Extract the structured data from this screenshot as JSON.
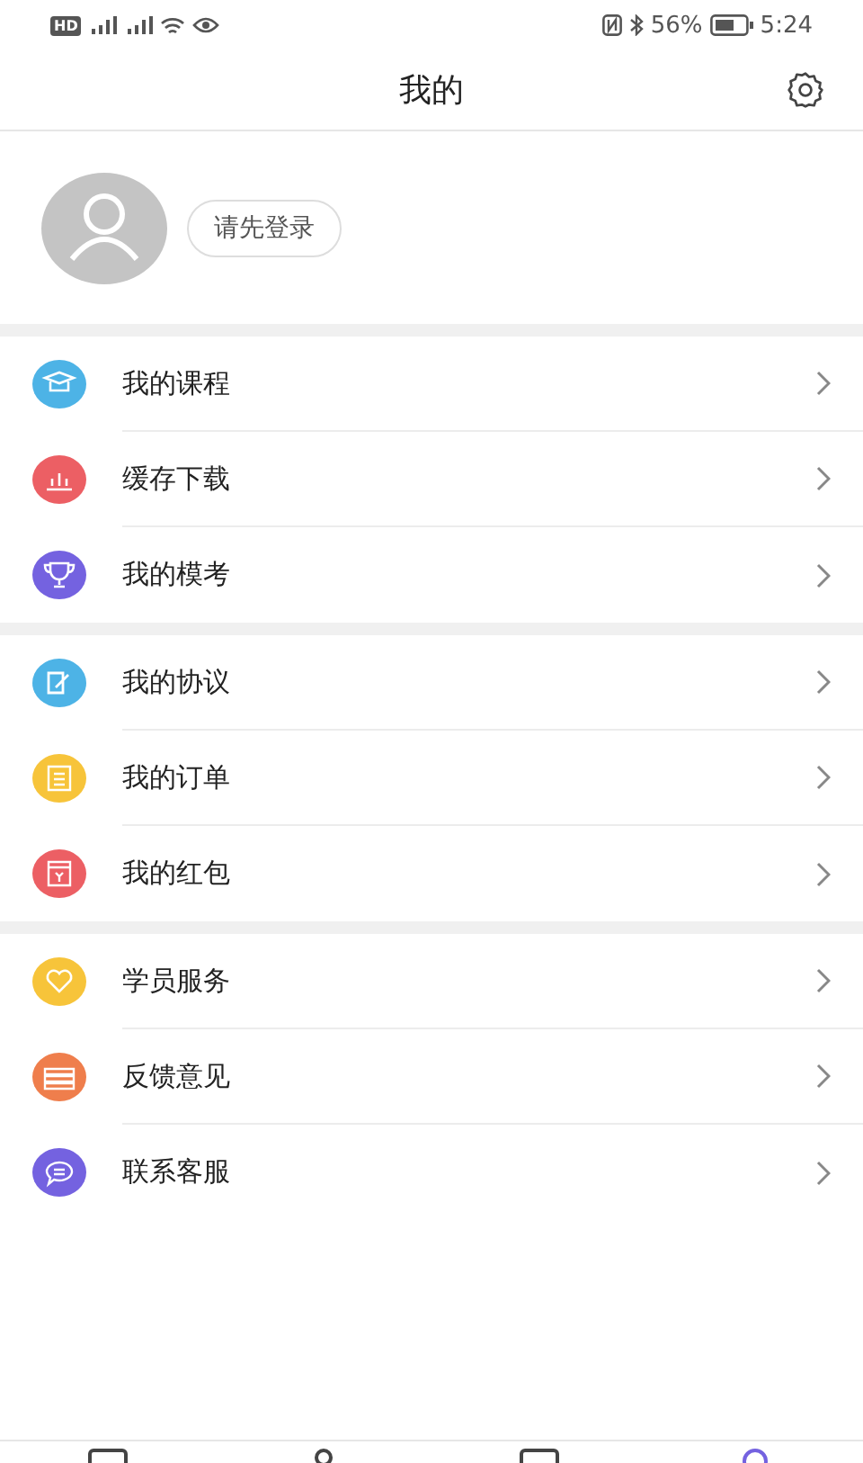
{
  "status_bar": {
    "hd": "HD",
    "battery": "56%",
    "time": "5:24"
  },
  "header": {
    "title": "我的"
  },
  "profile": {
    "login_button": "请先登录"
  },
  "menu_groups": [
    [
      {
        "label": "我的课程",
        "color": "#4db3e6"
      },
      {
        "label": "缓存下载",
        "color": "#ec5f64"
      },
      {
        "label": "我的模考",
        "color": "#7462e0"
      }
    ],
    [
      {
        "label": "我的协议",
        "color": "#4db3e6"
      },
      {
        "label": "我的订单",
        "color": "#f7c43a"
      },
      {
        "label": "我的红包",
        "color": "#ec5f64"
      }
    ],
    [
      {
        "label": "学员服务",
        "color": "#f7c43a"
      },
      {
        "label": "反馈意见",
        "color": "#ef7e4c"
      },
      {
        "label": "联系客服",
        "color": "#7462e0"
      }
    ]
  ],
  "tab_bar": [
    {
      "selected": false
    },
    {
      "selected": false
    },
    {
      "selected": false
    },
    {
      "selected": true
    }
  ]
}
